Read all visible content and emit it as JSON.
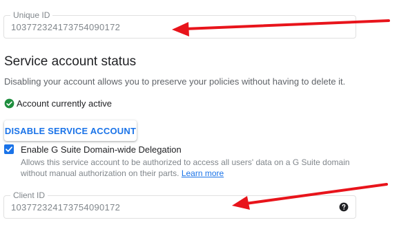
{
  "unique_id": {
    "label": "Unique ID",
    "value": "103772324173754090172"
  },
  "status_section": {
    "title": "Service account status",
    "description": "Disabling your account allows you to preserve your policies without having to delete it.",
    "active_text": "Account currently active",
    "active_color": "#1e8e3e",
    "disable_button_label": "DISABLE SERVICE ACCOUNT"
  },
  "delegation": {
    "checkbox_label": "Enable G Suite Domain-wide Delegation",
    "checked": true,
    "help_text_1": "Allows this service account to be authorized to access all users' data on a G Suite domain",
    "help_text_2": "without manual authorization on their parts.",
    "learn_more": "Learn more"
  },
  "client_id": {
    "label": "Client ID",
    "value": "103772324173754090172",
    "help_icon": "question-circle-icon"
  },
  "annotation": {
    "arrow_color": "#e8141b"
  },
  "colors": {
    "accent": "#1a73e8"
  }
}
